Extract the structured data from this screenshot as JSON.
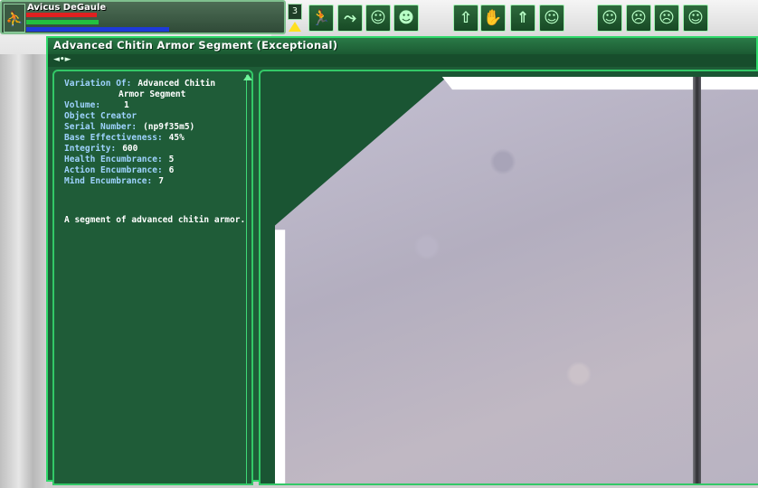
{
  "player": {
    "name": "Avicus DeGaule",
    "health_fraction": 0.49,
    "action_fraction": 0.5,
    "mind_fraction": 1.0
  },
  "level_indicator": "3",
  "toolbar": {
    "slots": [
      {
        "icon": "run-icon",
        "glyph": "🏃"
      },
      {
        "icon": "walk-icon",
        "glyph": "⤳"
      },
      {
        "icon": "smile-icon",
        "glyph": "☺"
      },
      {
        "icon": "grin-icon",
        "glyph": "☻"
      },
      {
        "icon": "stand-icon",
        "glyph": "⇧"
      },
      {
        "icon": "hand-icon",
        "glyph": "✋"
      },
      {
        "icon": "kneel-icon",
        "glyph": "⇑"
      },
      {
        "icon": "happy-icon",
        "glyph": "☺"
      },
      {
        "icon": "face-neutral-icon",
        "glyph": "☺"
      },
      {
        "icon": "face-angry-icon",
        "glyph": "☹"
      },
      {
        "icon": "face-sad-icon",
        "glyph": "☹"
      },
      {
        "icon": "face-plain-icon",
        "glyph": "☺"
      }
    ]
  },
  "window": {
    "title": "Advanced Chitin Armor Segment (Exceptional)",
    "tab_arrows": "◄•►",
    "attributes": {
      "variation_label": "Variation Of:",
      "variation_value_1": "Advanced Chitin",
      "variation_value_2": "Armor Segment",
      "volume_label": "Volume:",
      "volume_value": "1",
      "creator_label": "Object Creator",
      "serial_label": "Serial Number:",
      "serial_value": "(np9f35m5)",
      "base_eff_label": "Base Effectiveness:",
      "base_eff_value": "45%",
      "integrity_label": "Integrity:",
      "integrity_value": "600",
      "health_enc_label": "Health Encumbrance:",
      "health_enc_value": "5",
      "action_enc_label": "Action Encumbrance:",
      "action_enc_value": "6",
      "mind_enc_label": "Mind Encumbrance:",
      "mind_enc_value": "7"
    },
    "description": "A segment of advanced chitin armor."
  },
  "colors": {
    "panel_green": "#1f5c38",
    "border_green": "#33c867",
    "label_blue": "#9fd3ff",
    "health_red": "#e02020",
    "action_green": "#22c040",
    "mind_blue": "#1e3ad8"
  }
}
